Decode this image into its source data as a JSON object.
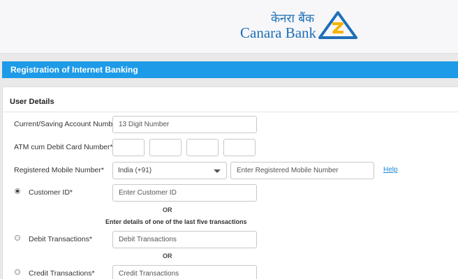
{
  "header": {
    "logo_hindi": "केनरा बैंक",
    "logo_text": "Canara Bank",
    "brand_color": "#1d6fb8",
    "accent_color": "#f5b400"
  },
  "title_bar": {
    "text": "Registration of Internet Banking",
    "color": "#1e9be8"
  },
  "section": {
    "title": "User Details"
  },
  "form": {
    "account": {
      "label": "Current/Saving Account Number*",
      "placeholder": "13 Digit Number"
    },
    "card": {
      "label": "ATM cum Debit Card Number*"
    },
    "mobile": {
      "label": "Registered Mobile Number*",
      "country_selected": "India (+91)",
      "placeholder": "Enter Registered Mobile Number",
      "help_link": "Help"
    },
    "customer_id": {
      "label": "Customer ID*",
      "placeholder": "Enter Customer ID",
      "selected": true
    },
    "or_1": "OR",
    "hint": "Enter details of one of the last five transactions",
    "debit": {
      "label": "Debit Transactions*",
      "placeholder": "Debit Transactions",
      "selected": false
    },
    "or_2": "OR",
    "credit": {
      "label": "Credit Transactions*",
      "placeholder": "Credit Transactions",
      "selected": false
    }
  }
}
